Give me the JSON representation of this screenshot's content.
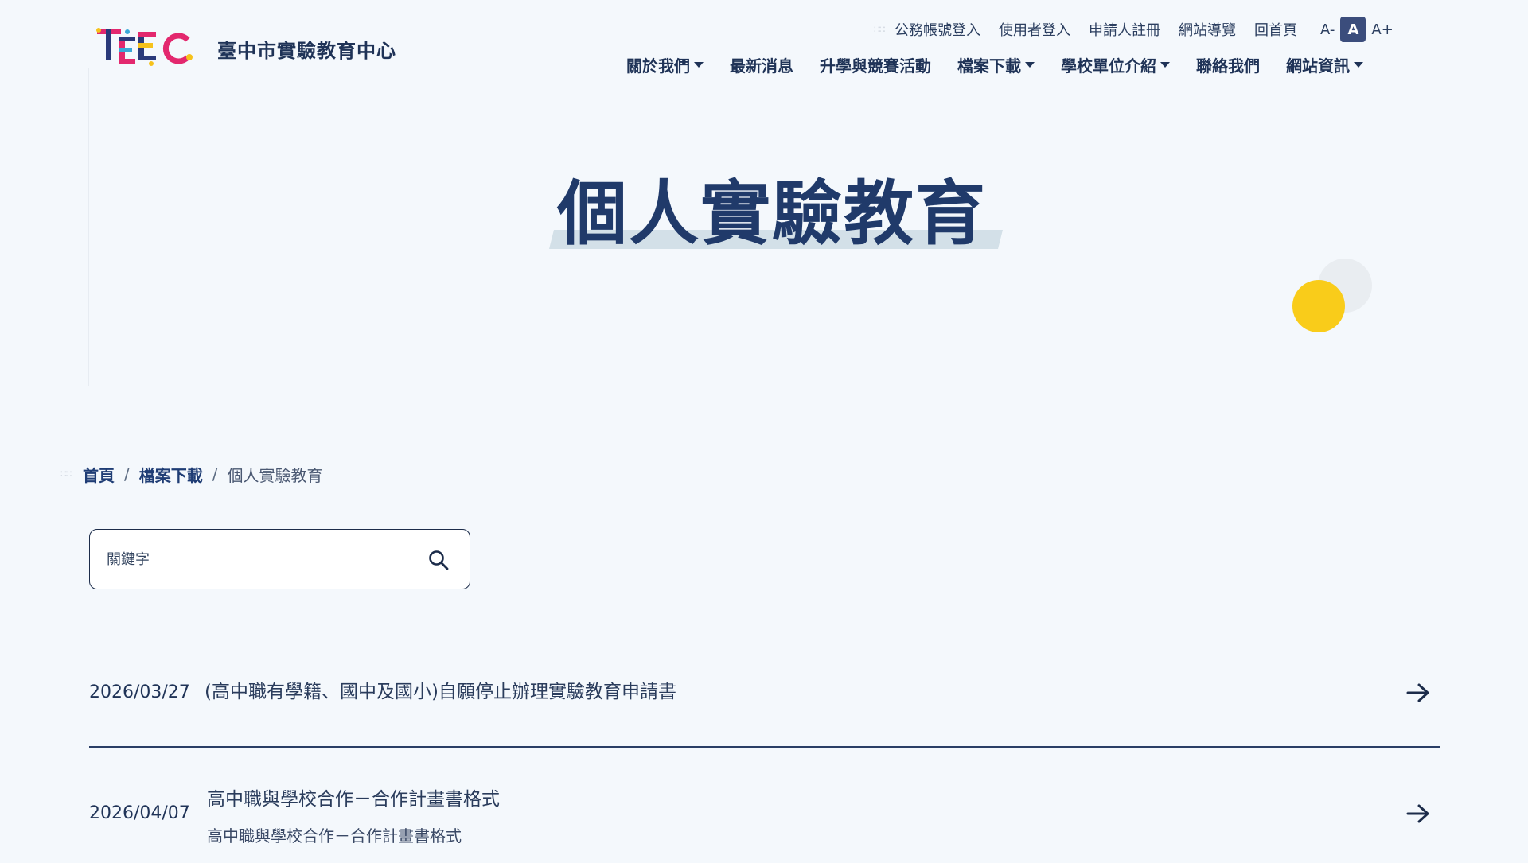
{
  "header": {
    "site_name": "臺中市實驗教育中心",
    "logo_colors": [
      "#e3286e",
      "#2a3a7a",
      "#f6c21b",
      "#3aa8d8"
    ]
  },
  "util_nav": {
    "items": [
      {
        "label": "公務帳號登入"
      },
      {
        "label": "使用者登入"
      },
      {
        "label": "申請人註冊"
      },
      {
        "label": "網站導覽"
      },
      {
        "label": "回首頁"
      }
    ],
    "font_sizes": {
      "small": "A-",
      "normal": "A",
      "large": "A+",
      "selected": "normal"
    }
  },
  "main_nav": {
    "items": [
      {
        "label": "關於我們",
        "dropdown": true
      },
      {
        "label": "最新消息",
        "dropdown": false
      },
      {
        "label": "升學與競賽活動",
        "dropdown": false
      },
      {
        "label": "檔案下載",
        "dropdown": true
      },
      {
        "label": "學校單位介紹",
        "dropdown": true
      },
      {
        "label": "聯絡我們",
        "dropdown": false
      },
      {
        "label": "網站資訊",
        "dropdown": true
      }
    ]
  },
  "hero": {
    "title": "個人實驗教育",
    "accent_color": "#f9cc1a"
  },
  "breadcrumb": {
    "home": "首頁",
    "separator": "/",
    "section": "檔案下載",
    "current": "個人實驗教育"
  },
  "search": {
    "placeholder": "關鍵字",
    "value": ""
  },
  "files": [
    {
      "date": "2026/03/27",
      "title": "(高中職有學籍、國中及國小)自願停止辦理實驗教育申請書",
      "description": ""
    },
    {
      "date": "2026/04/07",
      "title": "高中職與學校合作－合作計畫書格式",
      "description": "高中職與學校合作－合作計畫書格式"
    }
  ]
}
